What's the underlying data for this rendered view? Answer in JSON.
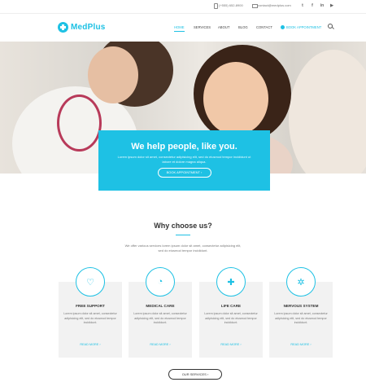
{
  "topbar": {
    "phone": "(+555) 652-8900",
    "email": "contact@medplus.com",
    "social": [
      {
        "icon": "twitter-icon",
        "glyph": "t"
      },
      {
        "icon": "facebook-icon",
        "glyph": "f"
      },
      {
        "icon": "linkedin-icon",
        "glyph": "in"
      },
      {
        "icon": "youtube-icon",
        "glyph": "▶"
      }
    ]
  },
  "nav": {
    "logo": "MedPlus",
    "items": [
      "HOME",
      "SERVICES",
      "ABOUT",
      "BLOG",
      "CONTACT"
    ],
    "active": "HOME",
    "cta": "BOOK APPOINTMENT"
  },
  "hero": {
    "title": "We help people, like you.",
    "text": "Lorem ipsum dolor sit amet, consectetur adipisicing elit, sed do eiusmod tempor incididunt ut labore et dolore magna aliqua.",
    "button": "BOOK APPOINTMENT ›"
  },
  "why": {
    "title": "Why choose us?",
    "subtitle": "We offer various services lorem ipsum dolor sit amet, consectetur adipisicing elit, sed do eiusmod tempor incididunt.",
    "cards": [
      {
        "icon": "heart-icon",
        "glyph": "♡",
        "title": "FREE SUPPORT",
        "text": "Lorem ipsum dolor sit amet, consectetur adipisicing elit, sed do eiusmod tempor incididunt.",
        "link": "READ MORE ›"
      },
      {
        "icon": "apple-icon",
        "glyph": "◔",
        "title": "MEDICAL CARE",
        "text": "Lorem ipsum dolor sit amet, consectetur adipisicing elit, sed do eiusmod tempor incididunt.",
        "link": "READ MORE ›"
      },
      {
        "icon": "medical-cross-icon",
        "glyph": "✚",
        "title": "LIFE CARE",
        "text": "Lorem ipsum dolor sit amet, consectetur adipisicing elit, sed do eiusmod tempor incididunt.",
        "link": "READ MORE ›"
      },
      {
        "icon": "brain-icon",
        "glyph": "✲",
        "title": "NERVOUS SYSTEM",
        "text": "Lorem ipsum dolor sit amet, consectetur adipisicing elit, sed do eiusmod tempor incididunt.",
        "link": "READ MORE ›"
      }
    ],
    "button": "OUR SERVICES ›"
  },
  "colors": {
    "accent": "#1ec1e4"
  }
}
